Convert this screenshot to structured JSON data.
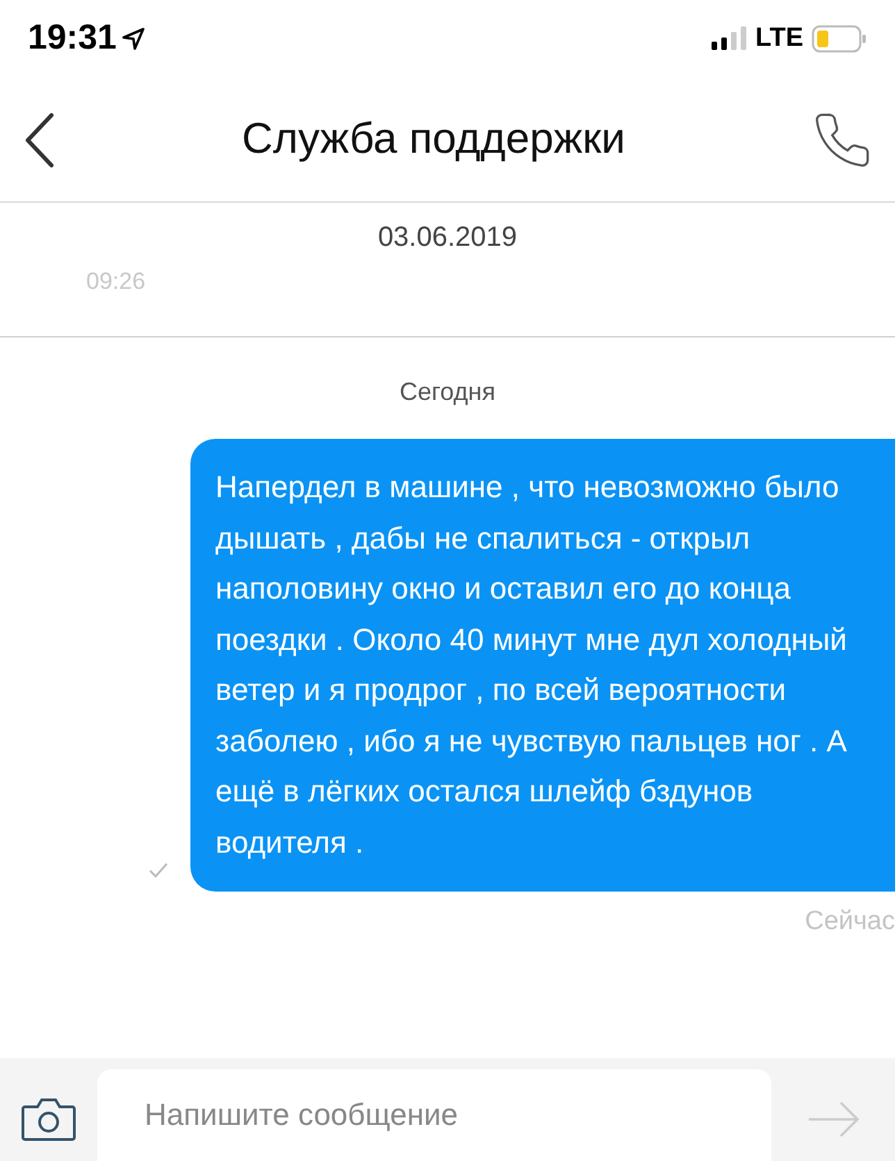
{
  "status_bar": {
    "time": "19:31",
    "network": "LTE"
  },
  "nav": {
    "title": "Служба поддержки"
  },
  "history": [
    {
      "kind": "date",
      "text": "03.06.2019"
    },
    {
      "kind": "time",
      "text": "09:26"
    }
  ],
  "today_label": "Сегодня",
  "messages": [
    {
      "text": "Напердел в машине , что невозможно было дышать , дабы не спалиться - открыл наполовину окно и оставил его до конца поездки . Около 40 минут мне дул холодный ветер и я продрог , по всей вероятности заболею , ибо я не чувствую пальцев ног . А ещё в лёгких остался шлейф бздунов водителя .",
      "delivered": true,
      "time": "Сейчас"
    }
  ],
  "composer": {
    "placeholder": "Напишите сообщение"
  }
}
